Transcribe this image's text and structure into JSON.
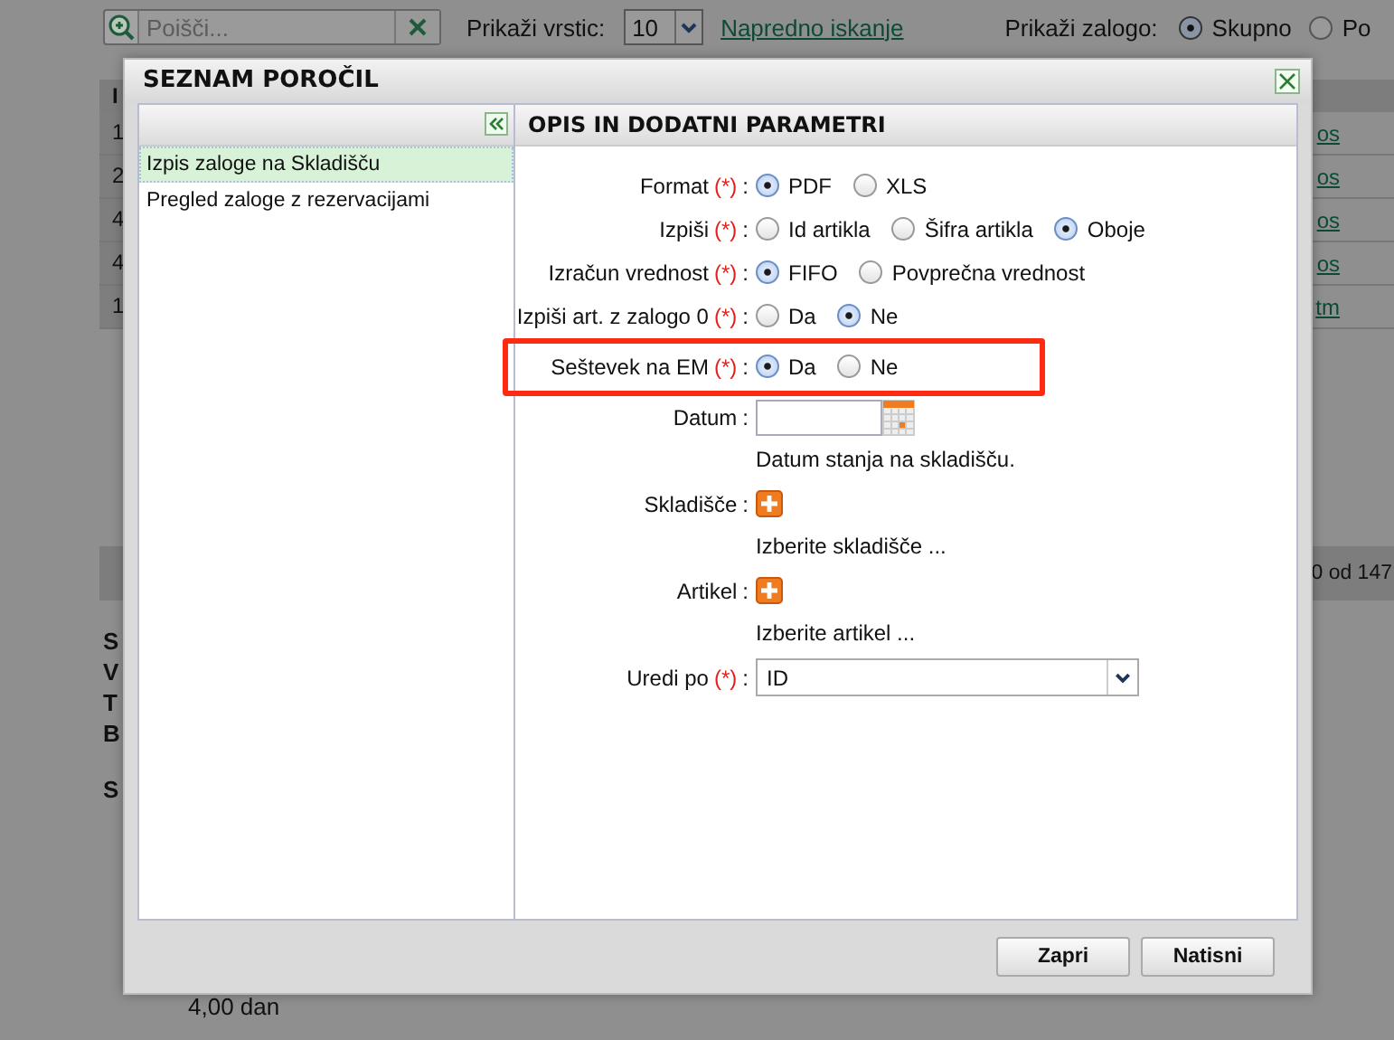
{
  "background": {
    "search": {
      "placeholder": "Poišči..."
    },
    "rows_label": "Prikaži vrstic:",
    "rows_select": {
      "value": "10"
    },
    "advanced_link": "Napredno iskanje",
    "stock_label": "Prikaži zalogo:",
    "stock_options": [
      {
        "label": "Skupno",
        "selected": true
      },
      {
        "label": "Po",
        "selected": false
      }
    ],
    "table": {
      "header_fragment": "I",
      "rows": [
        {
          "column_1": "1",
          "column_2": "os"
        },
        {
          "column_1": "2",
          "column_2": "os"
        },
        {
          "column_1": "4",
          "column_2": "os"
        },
        {
          "column_1": "4",
          "column_2": "os"
        },
        {
          "column_1": "1",
          "column_2": "tm"
        }
      ],
      "pager": "0 od 147"
    },
    "detail_fragments": [
      "S",
      "V",
      "T",
      "B",
      "S"
    ],
    "quantity": "4,00 dan"
  },
  "dialog": {
    "title": "SEZNAM POROČIL",
    "reports": [
      {
        "label": "Izpis zaloge na Skladišču",
        "selected": true
      },
      {
        "label": "Pregled zaloge z rezervacijami",
        "selected": false
      }
    ],
    "panel_title": "OPIS IN DODATNI PARAMETRI",
    "fields": [
      {
        "kind": "radio",
        "label": "Format",
        "required_mark": "(*)",
        "separator": ":",
        "options": [
          {
            "label": "PDF",
            "selected": true
          },
          {
            "label": "XLS",
            "selected": false
          }
        ]
      },
      {
        "kind": "radio",
        "label": "Izpiši",
        "required_mark": "(*)",
        "separator": ":",
        "options": [
          {
            "label": "Id artikla",
            "selected": false
          },
          {
            "label": "Šifra artikla",
            "selected": false
          },
          {
            "label": "Oboje",
            "selected": true
          }
        ]
      },
      {
        "kind": "radio",
        "label": "Izračun vrednost",
        "required_mark": "(*)",
        "separator": ":",
        "options": [
          {
            "label": "FIFO",
            "selected": true
          },
          {
            "label": "Povprečna vrednost",
            "selected": false
          }
        ]
      },
      {
        "kind": "radio",
        "label": "Izpiši art. z zalogo 0",
        "required_mark": "(*)",
        "separator": ":",
        "options": [
          {
            "label": "Da",
            "selected": false
          },
          {
            "label": "Ne",
            "selected": true
          }
        ]
      },
      {
        "kind": "radio",
        "label": "Seštevek na EM",
        "required_mark": "(*)",
        "separator": ":",
        "highlighted": true,
        "options": [
          {
            "label": "Da",
            "selected": true
          },
          {
            "label": "Ne",
            "selected": false
          }
        ]
      },
      {
        "kind": "date",
        "label": "Datum",
        "separator": ":",
        "hint": "Datum stanja na skladišču."
      },
      {
        "kind": "picker",
        "label": "Skladišče",
        "separator": ":",
        "hint": "Izberite skladišče ..."
      },
      {
        "kind": "picker",
        "label": "Artikel",
        "separator": ":",
        "hint": "Izberite artikel ..."
      },
      {
        "kind": "select",
        "label": "Uredi po",
        "required_mark": "(*)",
        "separator": ":",
        "value": "ID"
      }
    ],
    "buttons": [
      "Zapri",
      "Natisni"
    ]
  }
}
